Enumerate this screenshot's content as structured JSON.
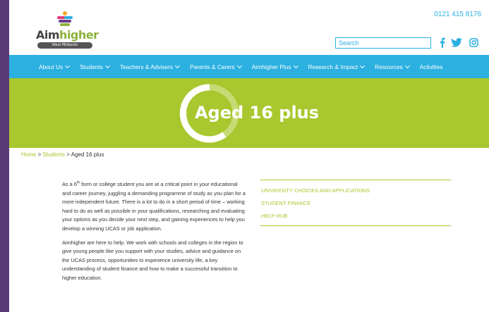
{
  "logo": {
    "word_aim": "Aim",
    "word_higher": "higher",
    "tagline": "West Midlands"
  },
  "header": {
    "phone": "0121 415 8176",
    "search_placeholder": "Search",
    "social_icons": [
      "facebook-icon",
      "twitter-icon",
      "instagram-icon"
    ]
  },
  "nav": {
    "items": [
      {
        "label": "About Us",
        "dropdown": true
      },
      {
        "label": "Students",
        "dropdown": true
      },
      {
        "label": "Teachers & Advisers",
        "dropdown": true
      },
      {
        "label": "Parents & Carers",
        "dropdown": true
      },
      {
        "label": "Aimhigher Plus",
        "dropdown": true
      },
      {
        "label": "Research & Impact",
        "dropdown": true
      },
      {
        "label": "Resources",
        "dropdown": true
      },
      {
        "label": "Activities",
        "dropdown": false
      }
    ]
  },
  "hero": {
    "title": "Aged 16 plus"
  },
  "breadcrumb": {
    "home": "Home",
    "sep1": " > ",
    "section": "Students",
    "sep2": " > ",
    "current": "Aged 16 plus"
  },
  "content": {
    "p1_before": "As a 6",
    "p1_sup": "th",
    "p1_after": " form or college student you are at a critical point in your educational and career journey, juggling a demanding programme of study as you plan for a more independent future. There is a lot to do in a short period of time – working hard to do as well as possible in your qualifications, researching and evaluating your options as you decide your next step, and gaining experiences to help you develop a winning UCAS or job application.",
    "p2": "Aimhigher are here to help.  We work with schools and colleges in the region to give young people like you support with your studies, advice and guidance on the UCAS process, opportunities to experience university life, a key understanding of student finance and how to make a successful transition to higher education."
  },
  "side_links": [
    "UNIVERSITY CHOICES AND APPLICATIONS",
    "STUDENT FINANCE",
    "HELP HUB"
  ],
  "colors": {
    "nav_blue": "#2bb0e0",
    "hero_green": "#a9c72e",
    "background_purple": "#5b3a78"
  }
}
